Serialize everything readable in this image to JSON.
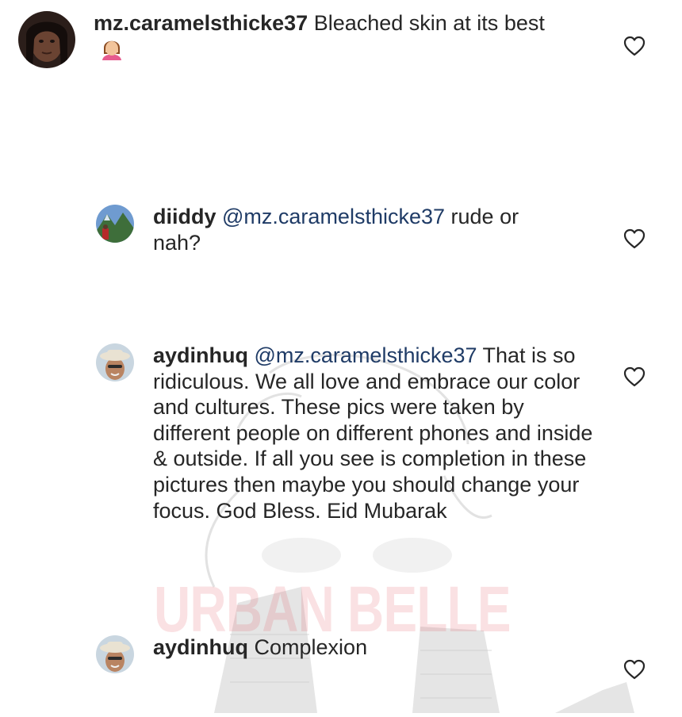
{
  "watermark": {
    "text": "URBAN BELLE"
  },
  "comments": [
    {
      "username": "mz.caramelsthicke37",
      "mention": "",
      "body": "Bleached skin at its best",
      "emoji_icon": "person-facepalming-icon",
      "is_reply": false
    },
    {
      "username": "diiddy",
      "mention": "@mz.caramelsthicke37",
      "body": "rude or nah?",
      "is_reply": true
    },
    {
      "username": "aydinhuq",
      "mention": "@mz.caramelsthicke37",
      "body": "That is so ridiculous. We all love  and embrace our color and cultures. These pics were taken by different  people on different phones and inside & outside. If all you see is completion in these pictures then maybe you should change your focus. God Bless. Eid Mubarak",
      "is_reply": true
    },
    {
      "username": "aydinhuq",
      "mention": "",
      "body": "Complexion",
      "is_reply": true
    }
  ],
  "icons": {
    "like": "heart-outline-icon"
  },
  "colors": {
    "text": "#262626",
    "mention": "#1f3b66",
    "watermark": "#e15a64"
  }
}
